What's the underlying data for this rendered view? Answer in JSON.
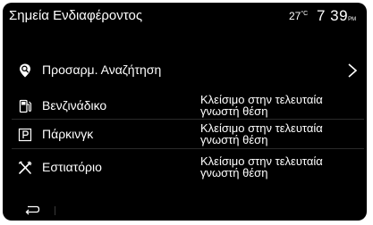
{
  "header": {
    "title": "Σημεία Ενδιαφέροντος",
    "temperature": "27",
    "temperature_unit": "°C",
    "time": "7 39",
    "time_suffix": "PM"
  },
  "menu": {
    "custom_search": {
      "label": "Προσαρμ. Αναζήτηση",
      "icon": "search-pin-icon"
    },
    "items": [
      {
        "label": "Βενζινάδικο",
        "icon": "fuel-icon",
        "status_line1": "Κλείσιμο στην τελευταία",
        "status_line2": "γνωστή θέση"
      },
      {
        "label": "Πάρκινγκ",
        "icon": "parking-icon",
        "status_line1": "Κλείσιμο στην τελευταία",
        "status_line2": "γνωστή θέση"
      },
      {
        "label": "Εστιατόριο",
        "icon": "restaurant-icon",
        "status_line1": "Κλείσιμο στην τελευταία",
        "status_line2": "γνωστή θέση"
      }
    ]
  },
  "footer": {
    "back_icon": "back-arrow-icon"
  },
  "colors": {
    "background": "#000000",
    "text": "#ffffff",
    "frame": "#ffffff"
  }
}
